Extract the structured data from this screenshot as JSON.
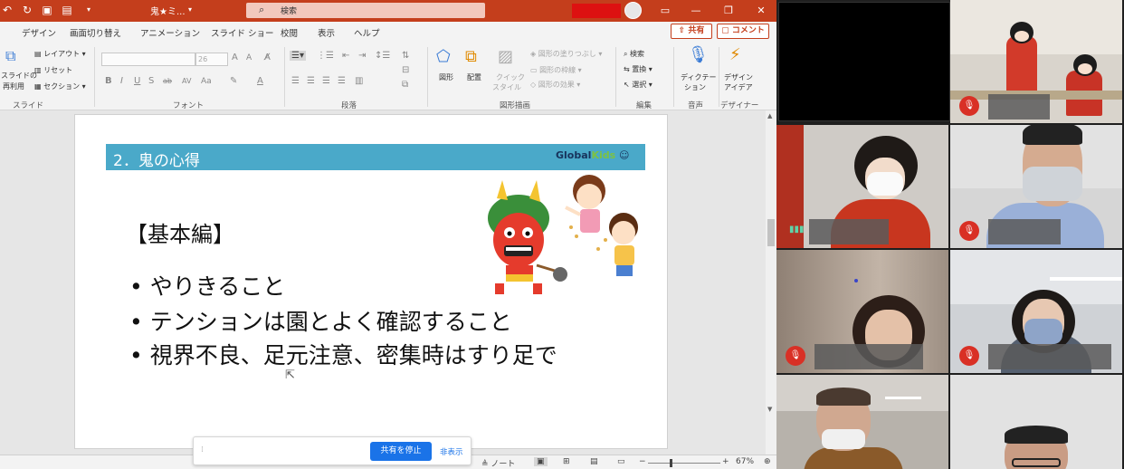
{
  "app": {
    "doc_title": "鬼★ミ...",
    "search_label": "検索"
  },
  "tabs": [
    "デザイン",
    "画面切り替え",
    "アニメーション",
    "スライド ショー",
    "校閲",
    "表示",
    "ヘルプ"
  ],
  "share_label": "共有",
  "comment_label": "コメント",
  "ribbon": {
    "slides_group": {
      "reuse_label_1": "スライドの",
      "reuse_label_2": "再利用",
      "layout": "レイアウト",
      "reset": "リセット",
      "section": "セクション",
      "group_label": "スライド"
    },
    "font_group": {
      "font_size": "26",
      "group_label": "フォント"
    },
    "paragraph_group": {
      "group_label": "段落"
    },
    "drawing_group": {
      "shapes": "図形",
      "arrange": "配置",
      "quick_styles_1": "クイック",
      "quick_styles_2": "スタイル",
      "fill": "図形の塗りつぶし",
      "outline": "図形の枠線",
      "effects": "図形の効果",
      "group_label": "図形描画"
    },
    "editing_group": {
      "find": "検索",
      "replace": "置換",
      "select": "選択",
      "group_label": "編集"
    },
    "voice_group": {
      "dictate_1": "ディクテー",
      "dictate_2": "ション",
      "group_label": "音声"
    },
    "designer_group": {
      "ideas_1": "デザイン",
      "ideas_2": "アイデア",
      "group_label": "デザイナー"
    }
  },
  "slide": {
    "heading": "2．鬼の心得",
    "logo_global": "Global",
    "logo_kids": "Kids",
    "subheading": "【基本編】",
    "bullets": [
      "やりきること",
      "テンションは園とよく確認すること",
      "視界不良、足元注意、密集時はすり足で"
    ]
  },
  "statusbar": {
    "notes": "ノート",
    "zoom": "67%"
  },
  "sharebar": {
    "stop": "共有を停止",
    "hide": "非表示"
  },
  "colors": {
    "ppt_accent": "#c43e1c",
    "banner": "#4aa9c9",
    "meet_blue": "#1a73e8",
    "mic_off": "#d93025"
  }
}
